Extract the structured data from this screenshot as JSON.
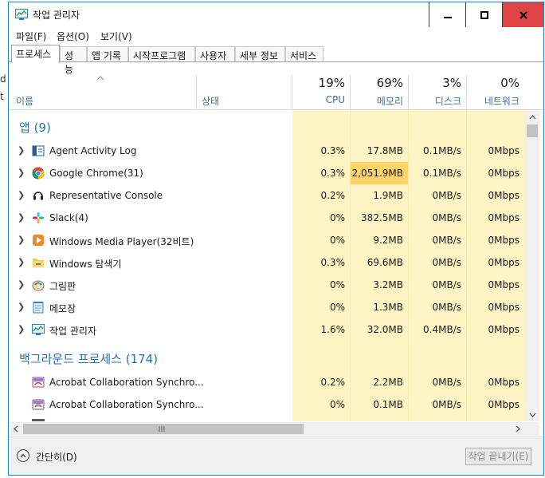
{
  "window": {
    "title": "작업 관리자"
  },
  "menu": [
    "파일(F)",
    "옵션(O)",
    "보기(V)"
  ],
  "tabs": [
    "프로세스",
    "성능",
    "앱 기록",
    "시작프로그램",
    "사용자",
    "세부 정보",
    "서비스"
  ],
  "active_tab": 0,
  "columns": {
    "name": "이름",
    "status": "상태",
    "cpu": {
      "pct": "19%",
      "label": "CPU"
    },
    "memory": {
      "pct": "69%",
      "label": "메모리"
    },
    "disk": {
      "pct": "3%",
      "label": "디스크"
    },
    "network": {
      "pct": "0%",
      "label": "네트워크"
    }
  },
  "groups": {
    "apps": "앱 (9)",
    "background": "백그라운드 프로세스 (174)"
  },
  "rows": [
    {
      "name": "Agent Activity Log",
      "cpu": "0.3%",
      "mem": "17.8MB",
      "disk": "0.1MB/s",
      "net": "0Mbps",
      "icon": "agent-log-icon",
      "expandable": true
    },
    {
      "name": "Google Chrome(31)",
      "cpu": "0.3%",
      "mem": "2,051.9MB",
      "disk": "0.1MB/s",
      "net": "0Mbps",
      "icon": "chrome-icon",
      "expandable": true
    },
    {
      "name": "Representative Console",
      "cpu": "0.2%",
      "mem": "1.9MB",
      "disk": "0MB/s",
      "net": "0Mbps",
      "icon": "headset-icon",
      "expandable": true
    },
    {
      "name": "Slack(4)",
      "cpu": "0%",
      "mem": "382.5MB",
      "disk": "0MB/s",
      "net": "0Mbps",
      "icon": "slack-icon",
      "expandable": true
    },
    {
      "name": "Windows Media Player(32비트)",
      "cpu": "0%",
      "mem": "9.2MB",
      "disk": "0MB/s",
      "net": "0Mbps",
      "icon": "media-player-icon",
      "expandable": true
    },
    {
      "name": "Windows 탐색기",
      "cpu": "0.3%",
      "mem": "69.6MB",
      "disk": "0MB/s",
      "net": "0Mbps",
      "icon": "explorer-icon",
      "expandable": true
    },
    {
      "name": "그림판",
      "cpu": "0%",
      "mem": "3.2MB",
      "disk": "0MB/s",
      "net": "0Mbps",
      "icon": "paint-icon",
      "expandable": true
    },
    {
      "name": "메모장",
      "cpu": "0%",
      "mem": "1.3MB",
      "disk": "0MB/s",
      "net": "0Mbps",
      "icon": "notepad-icon",
      "expandable": true
    },
    {
      "name": "작업 관리자",
      "cpu": "1.6%",
      "mem": "32.0MB",
      "disk": "0.4MB/s",
      "net": "0Mbps",
      "icon": "task-manager-icon",
      "expandable": true
    }
  ],
  "bg_rows": [
    {
      "name": "Acrobat Collaboration Synchro...",
      "cpu": "0.2%",
      "mem": "2.2MB",
      "disk": "0MB/s",
      "net": "0Mbps",
      "icon": "acrobat-sync-icon"
    },
    {
      "name": "Acrobat Collaboration Synchro...",
      "cpu": "0%",
      "mem": "0.1MB",
      "disk": "0MB/s",
      "net": "0Mbps",
      "icon": "acrobat-sync-icon"
    }
  ],
  "footer": {
    "fewer_details": "간단히(D)",
    "end_task": "작업 끝내기(E)"
  },
  "colors": {
    "heat_light": "#fff4c4",
    "heat_mem_high": "#ffd466",
    "group_text": "#2a6fb5",
    "close_button": "#e04343",
    "window_border": "#1883d7"
  }
}
